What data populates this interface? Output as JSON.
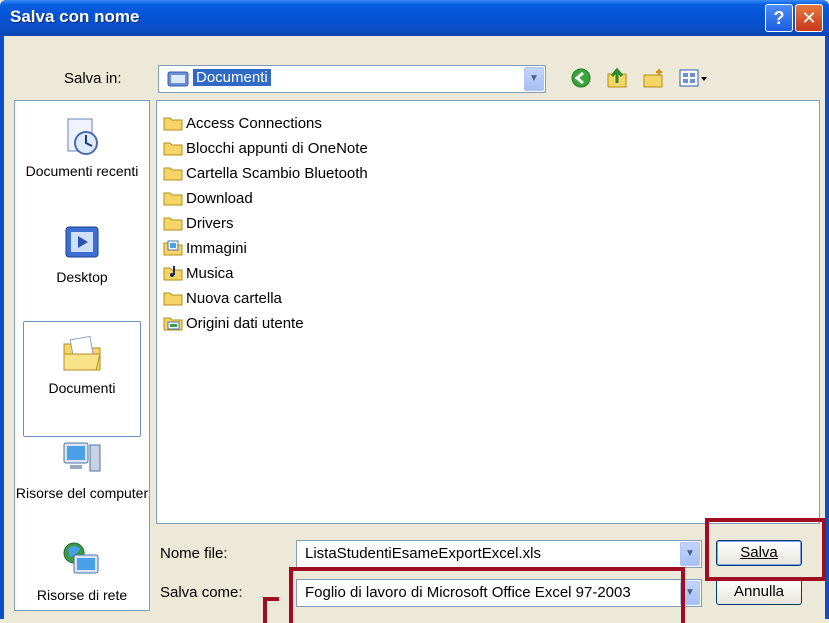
{
  "window": {
    "title": "Salva con nome"
  },
  "location": {
    "label": "Salva in:",
    "value": "Documenti"
  },
  "places": [
    {
      "label": "Documenti recenti"
    },
    {
      "label": "Desktop"
    },
    {
      "label": "Documenti"
    },
    {
      "label": "Risorse del computer"
    },
    {
      "label": "Risorse di rete"
    }
  ],
  "files": [
    {
      "name": "Access Connections"
    },
    {
      "name": "Blocchi appunti di OneNote"
    },
    {
      "name": "Cartella Scambio Bluetooth"
    },
    {
      "name": "Download"
    },
    {
      "name": "Drivers"
    },
    {
      "name": "Immagini"
    },
    {
      "name": "Musica"
    },
    {
      "name": "Nuova cartella"
    },
    {
      "name": "Origini dati utente"
    }
  ],
  "filename": {
    "label": "Nome file:",
    "value": "ListaStudentiEsameExportExcel.xls"
  },
  "filetype": {
    "label": "Salva come:",
    "value": "Foglio di lavoro di Microsoft Office Excel 97-2003"
  },
  "buttons": {
    "save": "Salva",
    "cancel": "Annulla"
  },
  "title_buttons": {
    "help": "?",
    "close": "✕"
  },
  "colors": {
    "highlight": "#a00d22",
    "titlebar": "#0a4fc8",
    "folder": "#f5d565"
  }
}
